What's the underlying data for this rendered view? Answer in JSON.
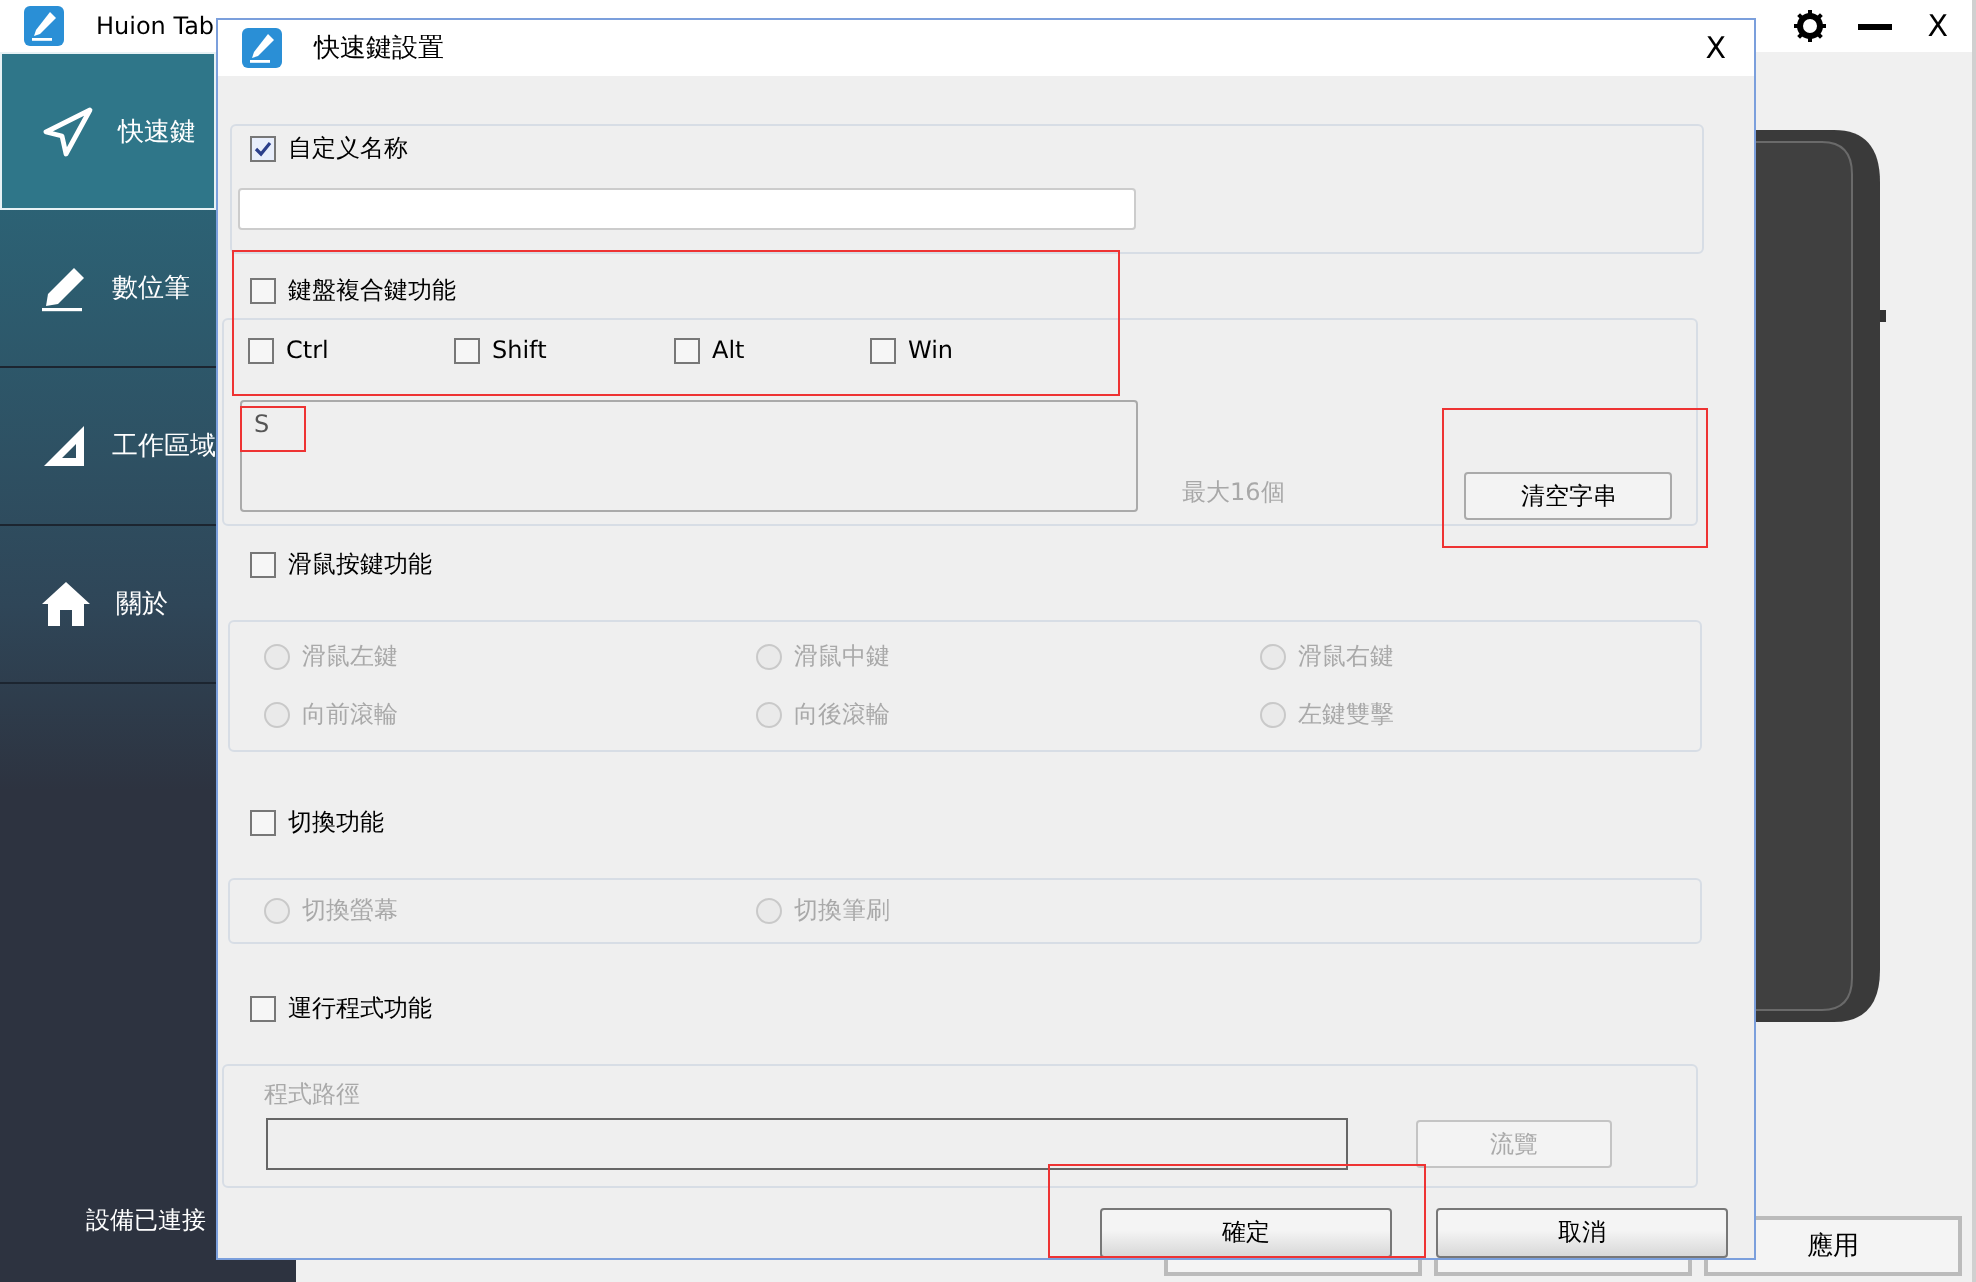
{
  "main_window": {
    "title": "Huion Tab",
    "sidebar": {
      "items": [
        {
          "label": "快速鍵",
          "selected": true
        },
        {
          "label": "數位筆",
          "selected": false
        },
        {
          "label": "工作區域",
          "selected": false
        },
        {
          "label": "關於",
          "selected": false
        }
      ],
      "status": "設備已連接"
    },
    "close": "X",
    "buttons": [
      "應用"
    ]
  },
  "dialog": {
    "title": "快速鍵設置",
    "close": "X",
    "name_section": {
      "label": "自定义名称",
      "checked": true
    },
    "keyboard_section": {
      "label": "鍵盤複合鍵功能",
      "checked": false,
      "modifiers": [
        {
          "label": "Ctrl",
          "checked": false
        },
        {
          "label": "Shift",
          "checked": false
        },
        {
          "label": "Alt",
          "checked": false
        },
        {
          "label": "Win",
          "checked": false
        }
      ],
      "keys": "S",
      "limit_note": "最大16個",
      "clear_button": "清空字串"
    },
    "mouse_section": {
      "label": "滑鼠按鍵功能",
      "checked": false,
      "disabled": true,
      "options": [
        {
          "label": "滑鼠左鍵",
          "selected": false
        },
        {
          "label": "滑鼠中鍵",
          "selected": false
        },
        {
          "label": "滑鼠右鍵",
          "selected": false
        },
        {
          "label": "向前滾輪",
          "selected": false
        },
        {
          "label": "向後滾輪",
          "selected": false
        },
        {
          "label": "左鍵雙擊",
          "selected": false
        }
      ]
    },
    "switch_section": {
      "label": "切換功能",
      "checked": false,
      "disabled": true,
      "options": [
        {
          "label": "切換螢幕",
          "selected": false
        },
        {
          "label": "切換筆刷",
          "selected": false
        }
      ]
    },
    "program_section": {
      "label": "運行程式功能",
      "checked": false,
      "disabled": true,
      "path_label": "程式路徑",
      "browse_button": "流覽"
    },
    "buttons": [
      "確定",
      "取消"
    ]
  }
}
